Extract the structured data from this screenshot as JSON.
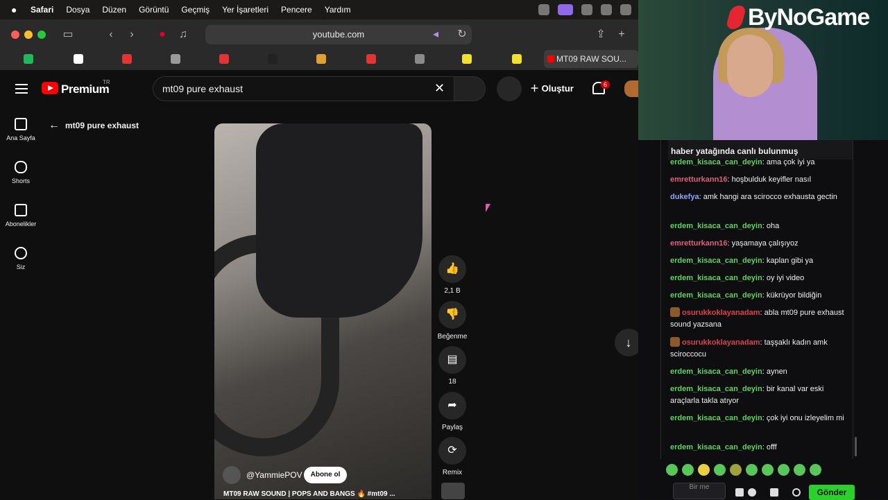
{
  "menubar": {
    "apple": "",
    "items": [
      "Safari",
      "Dosya",
      "Düzen",
      "Görüntü",
      "Geçmiş",
      "Yer İşaretleri",
      "Pencere",
      "Yardım"
    ]
  },
  "safari": {
    "address": "youtube.com",
    "active_tab": "MT09 RAW SOU...",
    "back_icon": "chevron-left-icon",
    "forward_icon": "chevron-right-icon",
    "bookmark_colors": [
      "#1fb85a",
      "#ffffff",
      "#e33333",
      "#9a9a9a",
      "#e33333",
      "#222222",
      "#e0a030",
      "#e33333",
      "#8a8a8a",
      "#f0e030",
      "#f0e030"
    ]
  },
  "youtube": {
    "logo_label": "Premium",
    "region": "TR",
    "search_value": "mt09 pure exhaust",
    "create_label": "Oluştur",
    "notif_count": "6",
    "sidebar": [
      {
        "label": "Ana Sayfa",
        "icon": "home-icon"
      },
      {
        "label": "Shorts",
        "icon": "shorts-icon"
      },
      {
        "label": "Abonelikler",
        "icon": "subscriptions-icon"
      },
      {
        "label": "Siz",
        "icon": "account-icon"
      }
    ],
    "back_label": "mt09 pure exhaust",
    "short": {
      "channel": "@YammiePOV",
      "subscribe": "Abone ol",
      "title": "MT09 RAW SOUND | POPS AND BANGS 🔥 #mt09 ..."
    },
    "actions": {
      "like_count": "2,1 B",
      "dislike_label": "Beğenme",
      "comments_count": "18",
      "share_label": "Paylaş",
      "remix_label": "Remix"
    }
  },
  "stream": {
    "brand": "ByNoGame",
    "pinned": "haber yatağında canlı bulunmuş",
    "messages": [
      {
        "user": "erdem_kisaca_can_deyin",
        "color": "#5fd35f",
        "text": "ama çok iyi ya",
        "badge": false
      },
      {
        "user": "emretturkann16",
        "color": "#e0607e",
        "text": "hoşbulduk keyifler nasıl",
        "badge": false
      },
      {
        "user": "dukefya",
        "color": "#8aa8ff",
        "text": "amk hangi ara scirocco exhausta gectin",
        "badge": false
      },
      {
        "user": "erdem_kisaca_can_deyin",
        "color": "#5fd35f",
        "text": "oha",
        "badge": false
      },
      {
        "user": "emretturkann16",
        "color": "#e0607e",
        "text": "yaşamaya çalışıyoz",
        "badge": false
      },
      {
        "user": "erdem_kisaca_can_deyin",
        "color": "#5fd35f",
        "text": "kaplan gibi ya",
        "badge": false
      },
      {
        "user": "erdem_kisaca_can_deyin",
        "color": "#5fd35f",
        "text": "oy iyi video",
        "badge": false
      },
      {
        "user": "erdem_kisaca_can_deyin",
        "color": "#5fd35f",
        "text": "kükrüyor bildiğin",
        "badge": false
      },
      {
        "user": "osurukkoklayanadam",
        "color": "#e0404a",
        "text": "abla mt09 pure exhaust sound yazsana",
        "badge": true
      },
      {
        "user": "osurukkoklayanadam",
        "color": "#e0404a",
        "text": "taşşaklı kadın amk sciroccocu",
        "badge": true
      },
      {
        "user": "erdem_kisaca_can_deyin",
        "color": "#5fd35f",
        "text": "aynen",
        "badge": false
      },
      {
        "user": "erdem_kisaca_can_deyin",
        "color": "#5fd35f",
        "text": "bir kanal var eski araçlarla takla atıyor",
        "badge": false
      },
      {
        "user": "erdem_kisaca_can_deyin",
        "color": "#5fd35f",
        "text": "çok iyi onu izleyelim mi",
        "badge": false
      },
      {
        "user": "erdem_kisaca_can_deyin",
        "color": "#5fd35f",
        "text": "offf",
        "badge": false
      }
    ],
    "input_placeholder": "Bir me",
    "send_label": "Gönder"
  }
}
